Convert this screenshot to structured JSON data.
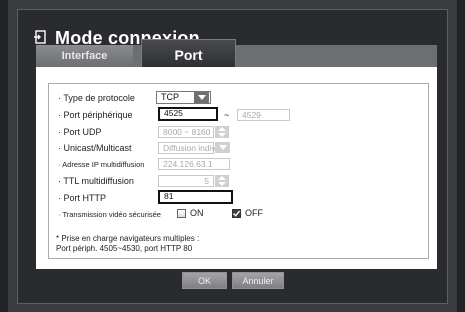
{
  "title": "Mode connexion",
  "tabs": [
    {
      "label": "Interface"
    },
    {
      "label": "Port"
    }
  ],
  "rows": {
    "protocol": {
      "label": "· Type de protocole",
      "value": "TCP"
    },
    "device_port": {
      "label": "· Port périphérique",
      "from": "4525",
      "to": "4529",
      "separator": "~"
    },
    "udp_port": {
      "label": "· Port UDP",
      "value": "8000 ~ 8160"
    },
    "unicast": {
      "label": "· Unicast/Multicast",
      "value": "Diffusion indiv..."
    },
    "multicast_ip": {
      "label": "· Adresse IP multidiffusion",
      "value": "224.126.63.1"
    },
    "ttl": {
      "label": "· TTL multidiffusion",
      "value": "5"
    },
    "http_port": {
      "label": "· Port HTTP",
      "value": "81"
    },
    "secure_video": {
      "label": "· Transmission vidéo sécurisée",
      "on_label": "ON",
      "off_label": "OFF",
      "selected": "OFF"
    }
  },
  "note": {
    "line1": "* Prise en charge navigateurs multiples :",
    "line2": "Port périph. 4505~4530, port HTTP 80"
  },
  "buttons": {
    "ok": "OK",
    "cancel": "Annuler"
  },
  "colors": {
    "background": "#222326",
    "dialog": "#2a2b2e",
    "panel": "#ffffff",
    "button": "#8f9094"
  }
}
